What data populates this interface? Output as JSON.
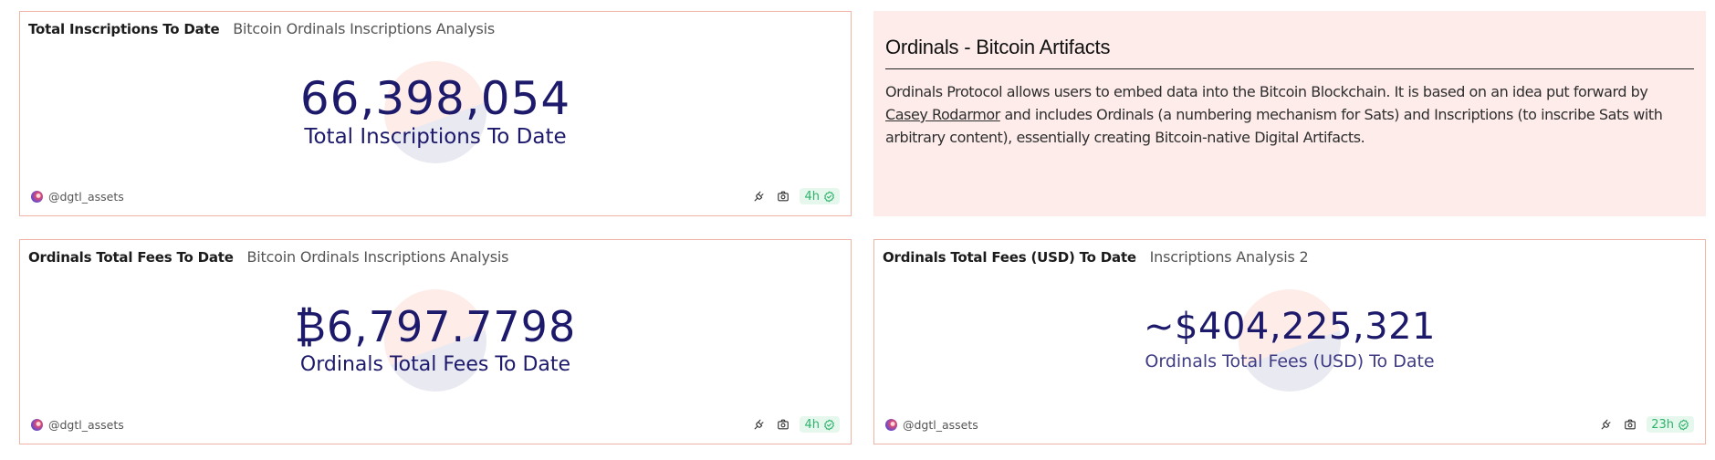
{
  "cards": [
    {
      "title": "Total Inscriptions To Date",
      "subtitle": "Bitcoin Ordinals Inscriptions Analysis",
      "value": "66,398,054",
      "label": "Total Inscriptions To Date",
      "author": "@dgtl_assets",
      "age": "4h",
      "icons": [
        "embed-icon",
        "camera-icon",
        "check-circle-icon"
      ]
    },
    {
      "title": "Ordinals Total Fees To Date",
      "subtitle": "Bitcoin Ordinals Inscriptions Analysis",
      "value": "₿6,797.7798",
      "label": "Ordinals Total Fees To Date",
      "author": "@dgtl_assets",
      "age": "4h",
      "icons": [
        "embed-icon",
        "camera-icon",
        "check-circle-icon"
      ]
    },
    {
      "title": "Ordinals Total Fees (USD) To Date",
      "subtitle": "Inscriptions Analysis 2",
      "value": "~$404,225,321",
      "label": "Ordinals Total Fees (USD) To Date",
      "author": "@dgtl_assets",
      "age": "23h",
      "icons": [
        "embed-icon",
        "camera-icon",
        "check-circle-icon"
      ]
    }
  ],
  "text_panel": {
    "heading": "Ordinals - Bitcoin Artifacts",
    "text_before_link": "Ordinals Protocol allows users to embed data into the Bitcoin Blockchain. It is based on an idea put forward by ",
    "link_text": "Casey Rodarmor",
    "text_after_link": " and includes Ordinals (a numbering mechanism for Sats) and Inscriptions (to inscribe Sats with arbitrary content), essentially creating Bitcoin-native Digital Artifacts."
  },
  "colors": {
    "card_border": "#f0b3a6",
    "panel_background": "#fdecea",
    "counter_text": "#1d1a6b",
    "badge_background": "#e6f7ee",
    "badge_text": "#2fb36b"
  }
}
